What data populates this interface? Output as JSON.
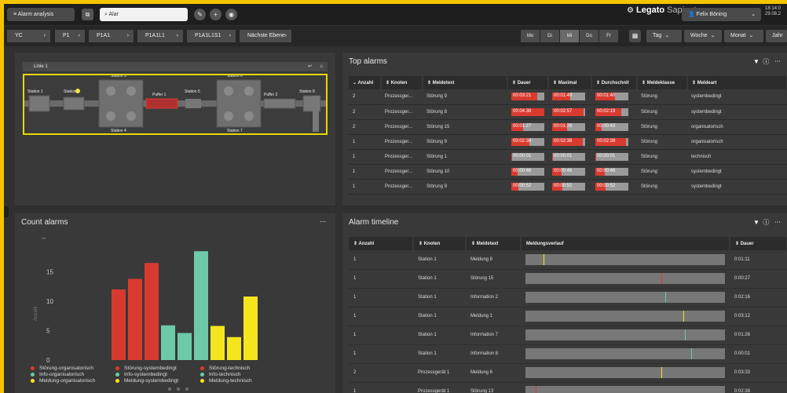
{
  "topbar": {
    "menu_label": "≡ Alarm analysis",
    "search_value": "Alar",
    "logo_brand": "Legato",
    "logo_suffix": "Sapient",
    "user_label": "Felix Böning",
    "time": "18:14:0",
    "date": "29.08.2"
  },
  "breadcrumbs": [
    "YC",
    "P1",
    "P1A1",
    "P1A1L1",
    "P1A1L1S1",
    "Nächste Ebene"
  ],
  "days": [
    "Mo",
    "Di",
    "Mi",
    "Do",
    "Fr"
  ],
  "active_day": "Mi",
  "granularity": [
    "Tag",
    "Woche",
    "Monat",
    "Jahr"
  ],
  "line_panel": {
    "tab_label": "Linie 1",
    "stations": [
      "Station 1",
      "Station 2",
      "Station 3",
      "Station 4",
      "Puffer 1",
      "Station 5",
      "Station 6",
      "Station 7",
      "Puffer 2",
      "Station 8"
    ]
  },
  "top_alarms": {
    "title": "Top alarms",
    "columns": [
      "Anzahl",
      "Knoten",
      "Meldetext",
      "Dauer",
      "Maximal",
      "Durchschnit",
      "Meldeklasse",
      "Meldeart"
    ],
    "rows": [
      {
        "anzahl": "2",
        "knoten": "Prozessger...",
        "meldetext": "Störung 9",
        "dauer": "00:03:21",
        "dauer_f": 0.78,
        "max": "00:01:49",
        "max_f": 0.55,
        "avg": "00:01:40",
        "avg_f": 0.6,
        "klasse": "Störung",
        "art": "systembedingt"
      },
      {
        "anzahl": "2",
        "knoten": "Prozessger...",
        "meldetext": "Störung 8",
        "dauer": "00:04:38",
        "dauer_f": 1.0,
        "max": "00:02:57",
        "max_f": 0.95,
        "avg": "00:02:19",
        "avg_f": 0.78,
        "klasse": "Störung",
        "art": "systembedingt"
      },
      {
        "anzahl": "2",
        "knoten": "Prozessger...",
        "meldetext": "Störung 15",
        "dauer": "00:01:27",
        "dauer_f": 0.35,
        "max": "00:01:26",
        "max_f": 0.45,
        "avg": "00:00:43",
        "avg_f": 0.2,
        "klasse": "Störung",
        "art": "organisatorisch"
      },
      {
        "anzahl": "1",
        "knoten": "Prozessger...",
        "meldetext": "Störung 9",
        "dauer": "00:02:38",
        "dauer_f": 0.55,
        "max": "00:02:38",
        "max_f": 0.92,
        "avg": "00:02:38",
        "avg_f": 0.92,
        "klasse": "Störung",
        "art": "organisatorisch"
      },
      {
        "anzahl": "1",
        "knoten": "Prozessger...",
        "meldetext": "Störung 1",
        "dauer": "00:00:01",
        "dauer_f": 0.02,
        "max": "00:00:01",
        "max_f": 0.02,
        "avg": "00:00:01",
        "avg_f": 0.02,
        "klasse": "Störung",
        "art": "technisch"
      },
      {
        "anzahl": "1",
        "knoten": "Prozessger...",
        "meldetext": "Störung 10",
        "dauer": "00:00:46",
        "dauer_f": 0.2,
        "max": "00:00:46",
        "max_f": 0.28,
        "avg": "00:00:46",
        "avg_f": 0.28,
        "klasse": "Störung",
        "art": "systembedingt"
      },
      {
        "anzahl": "1",
        "knoten": "Prozessger...",
        "meldetext": "Störung 9",
        "dauer": "00:00:52",
        "dauer_f": 0.22,
        "max": "00:00:52",
        "max_f": 0.3,
        "avg": "00:00:52",
        "avg_f": 0.3,
        "klasse": "Störung",
        "art": "systembedingt"
      }
    ]
  },
  "count_alarms": {
    "title": "Count alarms",
    "ylabel": "Anzahl"
  },
  "chart_data": {
    "type": "bar",
    "title": "Count alarms",
    "ylabel": "Anzahl",
    "ylim": [
      0,
      20
    ],
    "yticks": [
      0,
      5,
      10,
      15
    ],
    "top_tick": "--",
    "series": [
      {
        "name": "Störung-organisatorisch",
        "color": "#d93a30",
        "values": [
          12
        ]
      },
      {
        "name": "Störung-systembedingt",
        "color": "#d93a30",
        "values": [
          13.8
        ]
      },
      {
        "name": "Störung-technisch",
        "color": "#d93a30",
        "values": [
          16.5
        ]
      },
      {
        "name": "Info-organisatorisch",
        "color": "#6ec9a8",
        "values": [
          5.9
        ]
      },
      {
        "name": "Info-systembedingt",
        "color": "#6ec9a8",
        "values": [
          4.6
        ]
      },
      {
        "name": "Info-technisch",
        "color": "#6ec9a8",
        "values": [
          18.5
        ]
      },
      {
        "name": "Meldung-organisatorisch",
        "color": "#f5e51c",
        "values": [
          5.8
        ]
      },
      {
        "name": "Meldung-systembedingt",
        "color": "#f5e51c",
        "values": [
          3.9
        ]
      },
      {
        "name": "Meldung-technisch",
        "color": "#f5e51c",
        "values": [
          10.8
        ]
      }
    ]
  },
  "alarm_timeline": {
    "title": "Alarm timeline",
    "columns": [
      "Anzahl",
      "Knoten",
      "Meldetext",
      "Meldungsverlauf",
      "Dauer"
    ],
    "rows": [
      {
        "anzahl": "1",
        "knoten": "Station 1",
        "meldetext": "Meldung 8",
        "marker": 0.09,
        "color": "#f5e51c",
        "dauer": "0:01:11"
      },
      {
        "anzahl": "1",
        "knoten": "Station 1",
        "meldetext": "Störung 15",
        "marker": 0.68,
        "color": "#d93a30",
        "dauer": "0:00:27"
      },
      {
        "anzahl": "1",
        "knoten": "Station 1",
        "meldetext": "Information 2",
        "marker": 0.7,
        "color": "#6ec9a8",
        "dauer": "0:02:16"
      },
      {
        "anzahl": "1",
        "knoten": "Station 1",
        "meldetext": "Meldung 1",
        "marker": 0.79,
        "color": "#f5e51c",
        "dauer": "0:03:12"
      },
      {
        "anzahl": "1",
        "knoten": "Station 1",
        "meldetext": "Information 7",
        "marker": 0.8,
        "color": "#6ec9a8",
        "dauer": "0:01:26"
      },
      {
        "anzahl": "1",
        "knoten": "Station 1",
        "meldetext": "Information 8",
        "marker": 0.83,
        "color": "#6ec9a8",
        "dauer": "0:00:01"
      },
      {
        "anzahl": "2",
        "knoten": "Prozessgerät 1",
        "meldetext": "Meldung 6",
        "marker": 0.68,
        "color": "#f5e51c",
        "dauer": "0:03:33"
      },
      {
        "anzahl": "1",
        "knoten": "Prozessgerät 1",
        "meldetext": "Störung 13",
        "marker": 0.05,
        "color": "#d93a30",
        "dauer": "0:02:38"
      }
    ]
  }
}
